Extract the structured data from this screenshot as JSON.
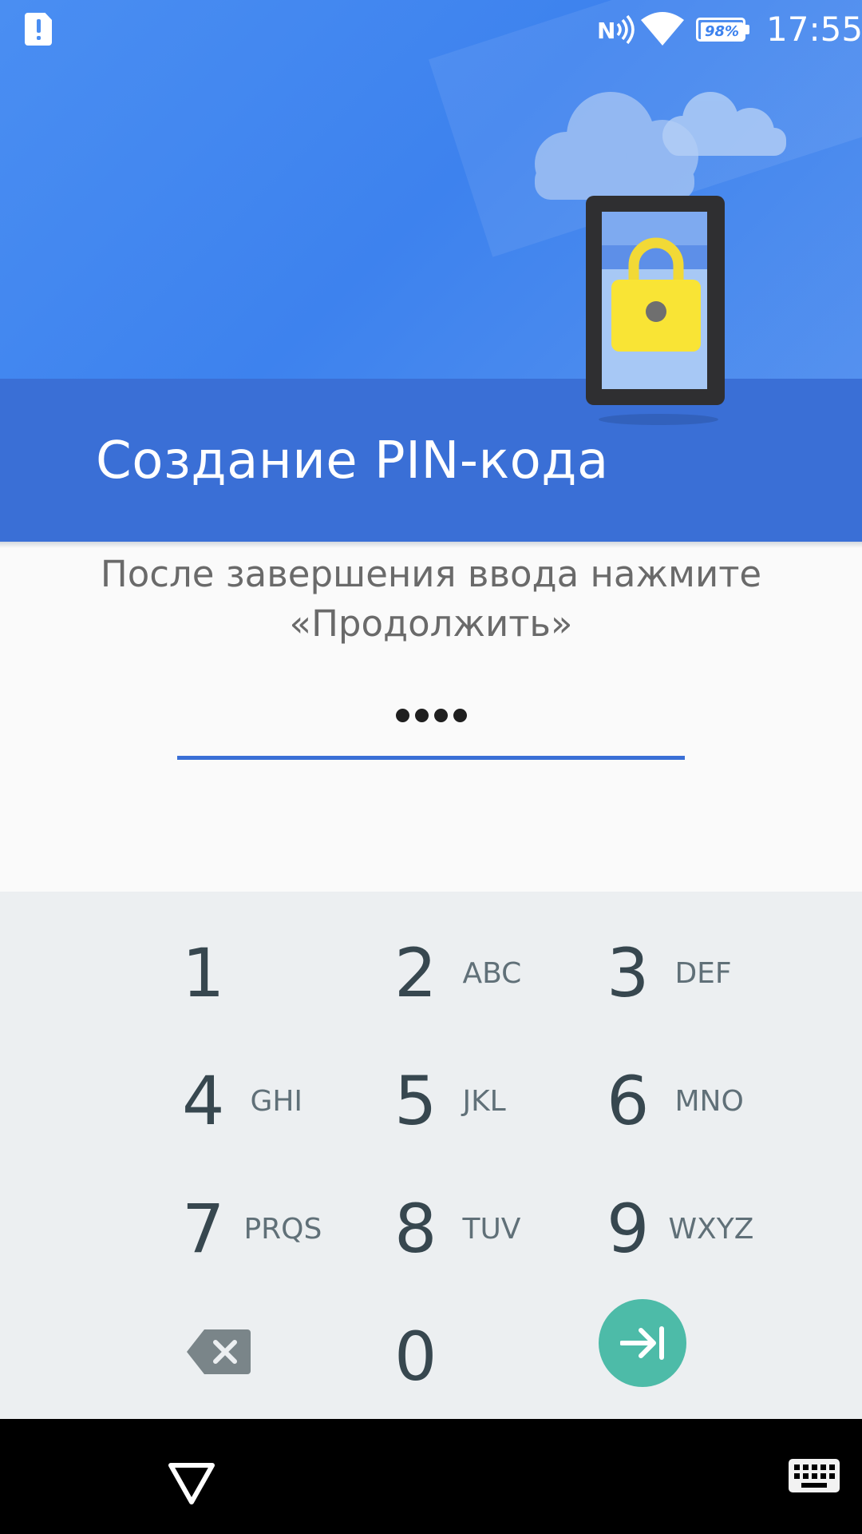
{
  "status_bar": {
    "time": "17:55",
    "battery": "98%",
    "icons": [
      "sim-alert-icon",
      "nfc-icon",
      "wifi-icon",
      "battery-icon"
    ]
  },
  "header": {
    "title": "Создание PIN-кода",
    "illustration": "tablet-padlock-illustration",
    "colors": {
      "background": "#4a8ef2",
      "band": "#3a6fd6"
    }
  },
  "instruction": {
    "line1": "После завершения ввода нажмите",
    "line2": "«Продолжить»"
  },
  "pin": {
    "entered_length": 4,
    "underline_color": "#3a6fd6"
  },
  "keypad": {
    "keys": [
      {
        "digit": "1",
        "letters": ""
      },
      {
        "digit": "2",
        "letters": "ABC"
      },
      {
        "digit": "3",
        "letters": "DEF"
      },
      {
        "digit": "4",
        "letters": "GHI"
      },
      {
        "digit": "5",
        "letters": "JKL"
      },
      {
        "digit": "6",
        "letters": "MNO"
      },
      {
        "digit": "7",
        "letters": "PRQS"
      },
      {
        "digit": "8",
        "letters": "TUV"
      },
      {
        "digit": "9",
        "letters": "WXYZ"
      },
      {
        "digit": "0",
        "letters": ""
      }
    ],
    "backspace_icon": "backspace-icon",
    "enter_icon": "arrow-to-end-icon",
    "enter_color": "#4dbba8"
  },
  "nav_bar": {
    "icons": [
      "back-icon",
      "keyboard-icon"
    ]
  }
}
